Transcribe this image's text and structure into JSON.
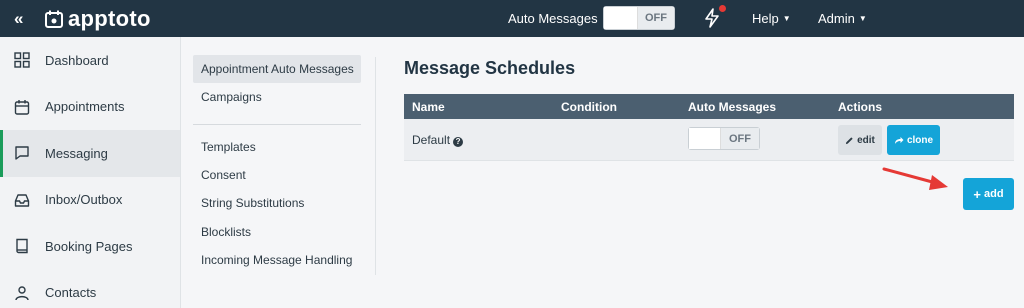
{
  "topbar": {
    "collapse_glyph": "«",
    "logo_text_bold": "app",
    "logo_text_rest": "toto",
    "auto_messages_label": "Auto Messages",
    "auto_messages_state": "OFF",
    "help_label": "Help",
    "admin_label": "Admin",
    "notification_color": "#e53935"
  },
  "sidebar": {
    "items": [
      {
        "label": "Dashboard",
        "icon": "grid-icon"
      },
      {
        "label": "Appointments",
        "icon": "calendar-icon"
      },
      {
        "label": "Messaging",
        "icon": "chat-icon",
        "active": true
      },
      {
        "label": "Inbox/Outbox",
        "icon": "inbox-icon"
      },
      {
        "label": "Booking Pages",
        "icon": "book-icon"
      },
      {
        "label": "Contacts",
        "icon": "user-icon"
      }
    ],
    "active_color": "#1a9c5a"
  },
  "subnav": {
    "group1": [
      "Appointment Auto Messages",
      "Campaigns"
    ],
    "group2": [
      "Templates",
      "Consent",
      "String Substitutions",
      "Blocklists",
      "Incoming Message Handling"
    ]
  },
  "main": {
    "title": "Message Schedules",
    "columns": [
      "Name",
      "Condition",
      "Auto Messages",
      "Actions"
    ],
    "rows": [
      {
        "name": "Default",
        "condition": "",
        "auto_messages": "OFF",
        "edit_label": "edit",
        "clone_label": "clone"
      }
    ],
    "add_label": "add",
    "accent": "#14a4d8"
  }
}
